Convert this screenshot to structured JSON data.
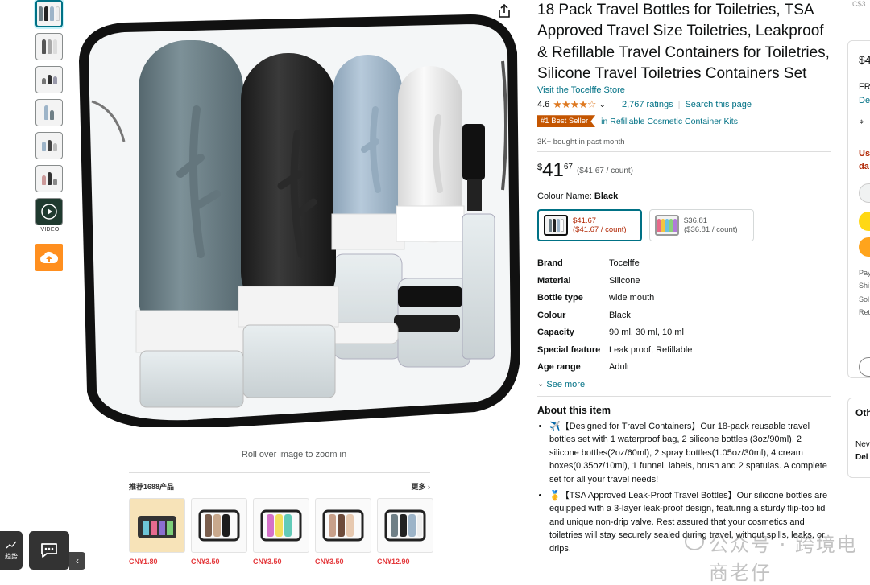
{
  "product": {
    "title": "18 Pack Travel Bottles for Toiletries, TSA Approved Travel Size Toiletries, Leakproof & Refillable Travel Containers for Toiletries, Silicone Travel Toiletries Containers Set",
    "store_link": "Visit the Tocelffe Store",
    "rating": "4.6",
    "ratings_count": "2,767 ratings",
    "search_page": "Search this page",
    "badge": "#1 Best Seller",
    "badge_category": "in Refillable Cosmetic Container Kits",
    "bought": "3K+ bought in past month",
    "price": {
      "currency": "$",
      "whole": "41",
      "fraction": "67",
      "unit": "($41.67 / count)"
    },
    "colour_label": "Colour Name:",
    "colour_value": "Black",
    "swatches": [
      {
        "price": "$41.67",
        "unit": "($41.67 / count)",
        "selected": true
      },
      {
        "price": "$36.81",
        "unit": "($36.81 / count)",
        "selected": false
      }
    ],
    "specs": [
      {
        "key": "Brand",
        "value": "Tocelffe"
      },
      {
        "key": "Material",
        "value": "Silicone"
      },
      {
        "key": "Bottle type",
        "value": "wide mouth"
      },
      {
        "key": "Colour",
        "value": "Black"
      },
      {
        "key": "Capacity",
        "value": "90 ml, 30 ml, 10 ml"
      },
      {
        "key": "Special feature",
        "value": "Leak proof, Refillable"
      },
      {
        "key": "Age range",
        "value": "Adult"
      }
    ],
    "see_more": "See more",
    "about_title": "About this item",
    "bullets": [
      "✈️【Designed for Travel Containers】Our 18-pack reusable travel bottles set with 1 waterproof bag, 2 silicone bottles (3oz/90ml), 2 silicone bottles(2oz/60ml), 2 spray bottles(1.05oz/30ml), 4 cream boxes(0.35oz/10ml), 1 funnel, labels, brush and 2 spatulas. A complete set for all your travel needs!",
      "🥇【TSA Approved Leak-Proof Travel Bottles】Our silicone bottles are equipped with a 3-layer leak-proof design, featuring a sturdy flip-top lid and unique non-drip valve. Rest assured that your cosmetics and toiletries will stay securely sealed during travel, without spills, leaks, or drips."
    ]
  },
  "gallery": {
    "video_label": "VIDEO",
    "zoom_hint": "Roll over image to zoom in"
  },
  "recommend": {
    "heading": "推荐1688产品",
    "more": "更多",
    "prices": [
      "CN¥1.80",
      "CN¥3.50",
      "CN¥3.50",
      "CN¥3.50",
      "CN¥12.90"
    ]
  },
  "corner": {
    "trend_label": "趋势"
  },
  "right_panel": {
    "top_price": "C$3",
    "price_digit": "$4",
    "fr": "FR",
    "de": "De",
    "us": "Us",
    "da": "da",
    "pay": "Pay",
    "shi": "Shi",
    "sol": "Sol",
    "ret": "Ret",
    "oth": "Oth",
    "new": "Nev",
    "del": "Del"
  },
  "watermark": "公众号 · 跨境电商老仔",
  "colors": {
    "link": "#007185",
    "badge": "#c45500",
    "star": "#de7921",
    "price_red": "#b12704",
    "rec_price": "#e4393c"
  }
}
